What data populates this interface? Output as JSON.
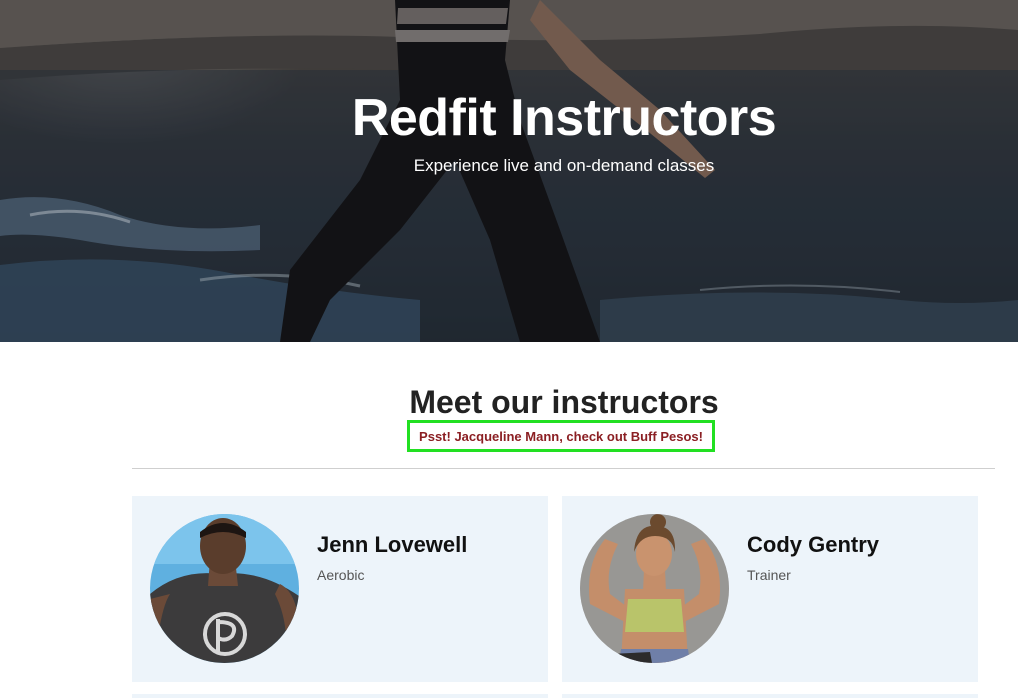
{
  "hero": {
    "title": "Redfit Instructors",
    "subtitle": "Experience live and on-demand classes",
    "image": "runner-on-beach-photo"
  },
  "section": {
    "title": "Meet our instructors",
    "promo": "Psst! Jacqueline Mann, check out Buff Pesos!"
  },
  "instructors": [
    {
      "name": "Jenn Lovewell",
      "role": "Aerobic",
      "avatar": "male-instructor-photo"
    },
    {
      "name": "Cody Gentry",
      "role": "Trainer",
      "avatar": "female-instructor-photo"
    }
  ],
  "colors": {
    "promo_text": "#8b1f23",
    "promo_border": "#22e022",
    "card_bg": "#edf4fa",
    "divider": "#cfcfcf"
  }
}
